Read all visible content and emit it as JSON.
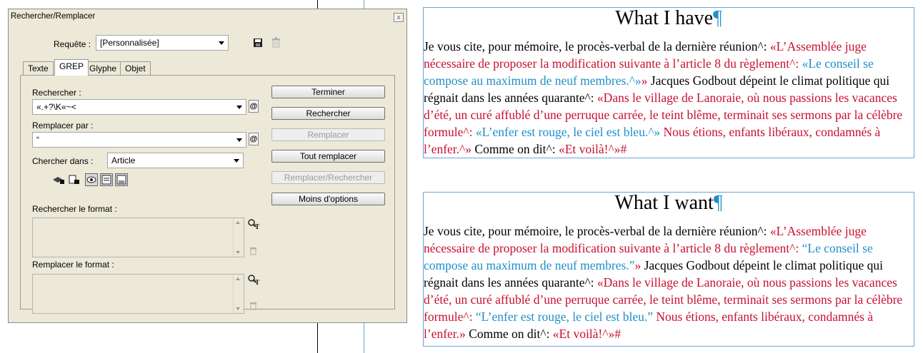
{
  "dialog": {
    "title": "Rechercher/Remplacer",
    "close_label": "x",
    "query_label": "Requête :",
    "query_value": "[Personnalisée]",
    "tabs": [
      "Texte",
      "GREP",
      "Glyphe",
      "Objet"
    ],
    "active_tab": "GREP",
    "find_label": "Rechercher :",
    "find_value": "«.+?\\K«~<",
    "replace_label": "Remplacer par :",
    "replace_value": "“",
    "special_char_label": "@",
    "search_in_label": "Chercher dans :",
    "search_in_value": "Article",
    "find_format_label": "Rechercher le format :",
    "replace_format_label": "Remplacer le format :",
    "buttons": {
      "done": "Terminer",
      "find": "Rechercher",
      "replace": "Remplacer",
      "replace_all": "Tout remplacer",
      "replace_find": "Remplacer/Rechercher",
      "fewer_options": "Moins d'options"
    }
  },
  "frames": [
    {
      "heading": "What I have",
      "pilcrow": "¶",
      "segments": [
        {
          "t": "Je vous cite, pour mémoire, le procès-verbal de la dernière réunion^: ",
          "c": "k"
        },
        {
          "t": "«L’Assemblée juge nécessaire de proposer la modification suivante à l’article 8 du règlement^: ",
          "c": "r"
        },
        {
          "t": "«Le conseil se compose au maximum de neuf membres.^»",
          "c": "b"
        },
        {
          "t": "» ",
          "c": "r"
        },
        {
          "t": "Jacques Godbout dépeint le climat politique qui régnait dans les années quarante^: ",
          "c": "k"
        },
        {
          "t": "«Dans le village de Lanoraie, où nous passions les vacances d’été, un curé affublé d’une perruque carrée, le teint blême, terminait ses sermons par la célèbre formule^: ",
          "c": "r"
        },
        {
          "t": "«L’enfer est rouge, le ciel est bleu.^»",
          "c": "b"
        },
        {
          "t": " Nous étions, enfants libéraux, condamnés à l’enfer.^» ",
          "c": "r"
        },
        {
          "t": "Comme on dit^: ",
          "c": "k"
        },
        {
          "t": "«Et voilà!^»#",
          "c": "r"
        }
      ]
    },
    {
      "heading": "What I want",
      "pilcrow": "¶",
      "segments": [
        {
          "t": "Je vous cite, pour mémoire, le procès-verbal de la dernière réunion^: ",
          "c": "k"
        },
        {
          "t": "«L’Assemblée juge nécessaire de proposer la modification suivante à l’article 8 du règlement^: ",
          "c": "r"
        },
        {
          "t": "“Le conseil se compose au maximum de neuf membres.”",
          "c": "b"
        },
        {
          "t": "» ",
          "c": "r"
        },
        {
          "t": "Jacques Godbout dépeint le climat politique qui régnait dans les années quarante^: ",
          "c": "k"
        },
        {
          "t": "«Dans le village de Lanoraie, où nous passions les vacances d’été, un curé affublé d’une perruque carrée, le teint blême, terminait ses sermons par la célèbre formule^: ",
          "c": "r"
        },
        {
          "t": "“L’enfer est rouge, le ciel est bleu.”",
          "c": "b"
        },
        {
          "t": " Nous étions, enfants libéraux, condamnés à l’enfer.» ",
          "c": "r"
        },
        {
          "t": "Comme on dit^: ",
          "c": "k"
        },
        {
          "t": "«Et voilà!^»#",
          "c": "r"
        }
      ]
    }
  ]
}
